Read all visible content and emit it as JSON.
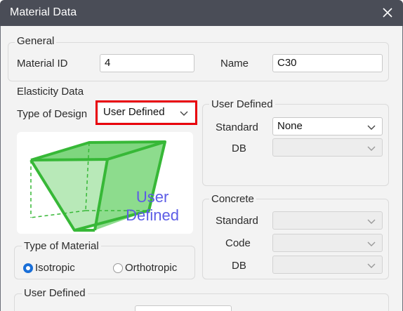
{
  "window": {
    "title": "Material Data"
  },
  "general": {
    "label": "General",
    "material_id_label": "Material ID",
    "material_id_value": "4",
    "name_label": "Name",
    "name_value": "C30"
  },
  "elasticity": {
    "label": "Elasticity Data",
    "type_of_design_label": "Type of Design",
    "type_of_design_value": "User Defined",
    "preview_line1": "User",
    "preview_line2": "Defined"
  },
  "user_defined_db": {
    "label": "User Defined",
    "standard_label": "Standard",
    "standard_value": "None",
    "db_label": "DB",
    "db_value": ""
  },
  "concrete": {
    "label": "Concrete",
    "standard_label": "Standard",
    "standard_value": "",
    "code_label": "Code",
    "code_value": "",
    "db_label": "DB",
    "db_value": ""
  },
  "type_of_material": {
    "label": "Type of Material",
    "options": [
      "Isotropic",
      "Orthotropic"
    ],
    "selected": "Isotropic"
  },
  "user_defined_bottom": {
    "label": "User Defined"
  },
  "colors": {
    "highlight": "#e8000b",
    "accent": "#1a6fd8",
    "box_green": "#3cbf3c",
    "preview_text": "#5c5ce6"
  }
}
